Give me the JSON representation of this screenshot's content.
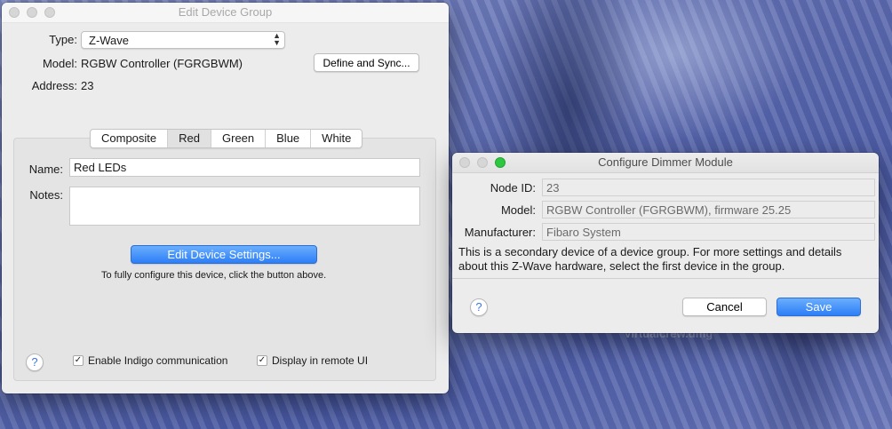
{
  "edit_window": {
    "title": "Edit Device Group",
    "type_label": "Type:",
    "type_value": "Z-Wave",
    "model_label": "Model:",
    "model_value": "RGBW Controller (FGRGBWM)",
    "define_sync_label": "Define and Sync...",
    "address_label": "Address:",
    "address_value": "23",
    "tabs": [
      "Composite",
      "Red",
      "Green",
      "Blue",
      "White"
    ],
    "selected_tab": "Red",
    "name_label": "Name:",
    "name_value": "Red LEDs",
    "notes_label": "Notes:",
    "notes_value": "",
    "edit_settings_label": "Edit Device Settings...",
    "hint": "To fully configure this device, click the button above.",
    "help": "?",
    "enable_comm_label": "Enable Indigo communication",
    "enable_comm_checked": true,
    "remote_ui_label": "Display in remote UI",
    "remote_ui_checked": true
  },
  "dimmer_window": {
    "title": "Configure Dimmer Module",
    "node_id_label": "Node ID:",
    "node_id_value": "23",
    "model_label": "Model:",
    "model_value": "RGBW Controller (FGRGBWM), firmware 25.25",
    "manufacturer_label": "Manufacturer:",
    "manufacturer_value": "Fibaro System",
    "info": "This is a secondary device of a device group. For more settings and details about this Z-Wave hardware, select the first device in the group.",
    "help": "?",
    "cancel_label": "Cancel",
    "save_label": "Save"
  },
  "desktop": {
    "watermark": "virtualcrew.dmg"
  },
  "colors": {
    "accent": "#2d7ef8",
    "window_bg": "#ececec"
  }
}
